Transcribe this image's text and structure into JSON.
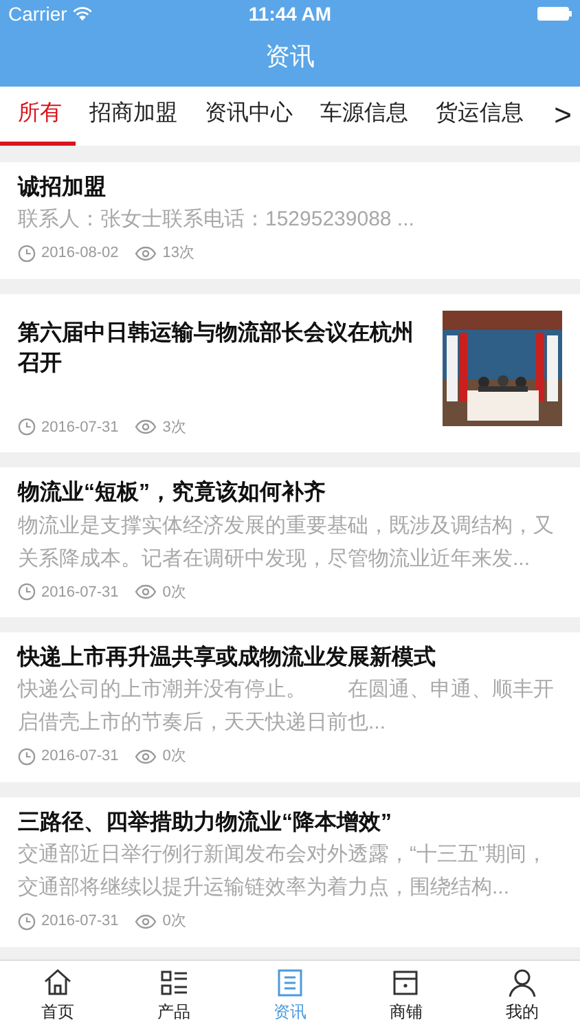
{
  "status_bar": {
    "carrier": "Carrier",
    "time": "11:44 AM"
  },
  "nav_bar": {
    "title": "资讯"
  },
  "tabs": [
    {
      "label": "所有",
      "selected": true
    },
    {
      "label": "招商加盟",
      "selected": false
    },
    {
      "label": "资讯中心",
      "selected": false
    },
    {
      "label": "车源信息",
      "selected": false
    },
    {
      "label": "货运信息",
      "selected": false
    }
  ],
  "tabs_more": ">",
  "articles": [
    {
      "title": "诚招加盟",
      "summary": "联系人：张女士联系电话：15295239088 ...",
      "date": "2016-08-02",
      "views": "13次"
    },
    {
      "title": "第六届中日韩运输与物流部长会议在杭州召开",
      "date": "2016-07-31",
      "views": "3次"
    },
    {
      "title": "物流业“短板”，究竟该如何补齐",
      "summary": "物流业是支撑实体经济发展的重要基础，既涉及调结构，又关系降成本。记者在调研中发现，尽管物流业近年来发...",
      "date": "2016-07-31",
      "views": "0次"
    },
    {
      "title": "快递上市再升温共享或成物流业发展新模式",
      "summary": "快递公司的上市潮并没有停止。　　在圆通、申通、顺丰开启借壳上市的节奏后，天天快递日前也...",
      "date": "2016-07-31",
      "views": "0次"
    },
    {
      "title": "三路径、四举措助力物流业“降本增效”",
      "summary": "交通部近日举行例行新闻发布会对外透露，“十三五”期间，交通部将继续以提升运输链效率为着力点，围绕结构...",
      "date": "2016-07-31",
      "views": "0次"
    }
  ],
  "tab_bar": [
    {
      "kind": "home",
      "label": "首页",
      "selected": false
    },
    {
      "kind": "list",
      "label": "产品",
      "selected": false
    },
    {
      "kind": "news",
      "label": "资讯",
      "selected": true
    },
    {
      "kind": "shop",
      "label": "商铺",
      "selected": false
    },
    {
      "kind": "person",
      "label": "我的",
      "selected": false
    }
  ]
}
